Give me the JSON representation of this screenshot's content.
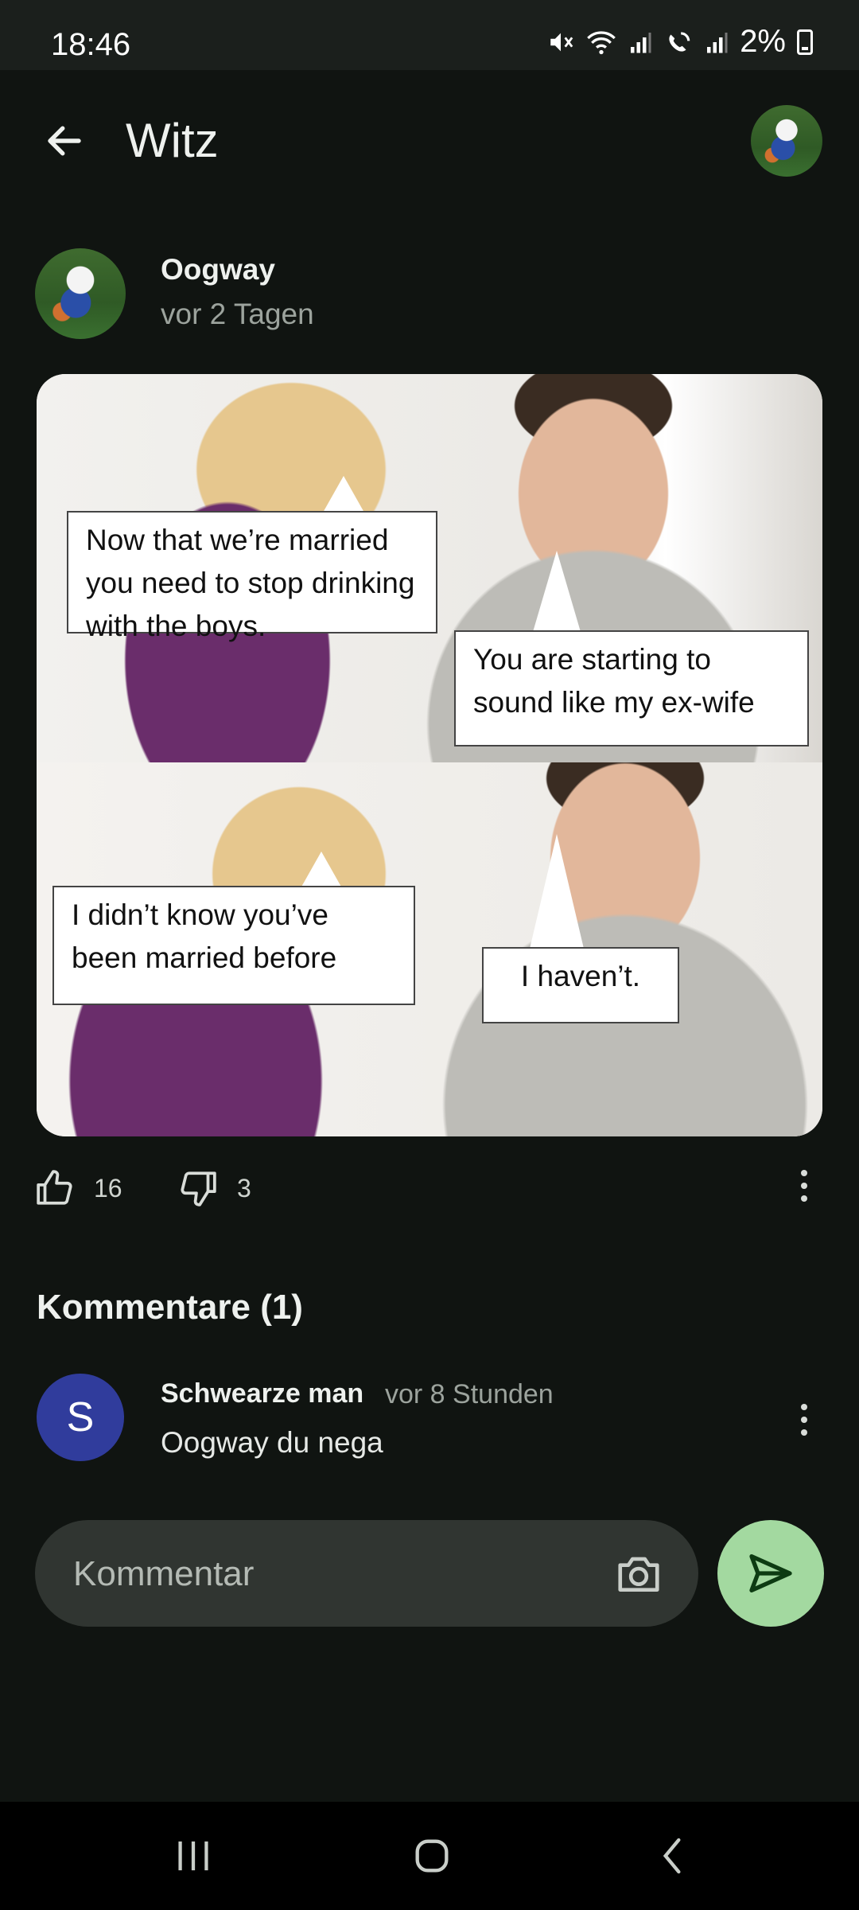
{
  "status_bar": {
    "time": "18:46",
    "battery": "2%"
  },
  "app_bar": {
    "title": "Witz",
    "back_icon": "arrow-left-icon"
  },
  "post": {
    "author": "Oogway",
    "time": "vor 2 Tagen",
    "meme": {
      "bubble_1": "Now that we’re married you need to stop drinking with the boys.",
      "bubble_2": "You are starting to sound like my ex-wife",
      "bubble_3": "I didn’t know you’ve been married before",
      "bubble_4": "I haven’t."
    },
    "likes": "16",
    "dislikes": "3"
  },
  "comments": {
    "heading": "Kommentare (1)",
    "items": [
      {
        "initial": "S",
        "author": "Schwearze man",
        "time": "vor 8 Stunden",
        "text": "Oogway du nega"
      }
    ]
  },
  "composer": {
    "placeholder": "Kommentar"
  },
  "colors": {
    "background": "#101411",
    "send_button": "#a3d9a0",
    "comment_avatar": "#303c9c",
    "input_bg": "#303531"
  }
}
